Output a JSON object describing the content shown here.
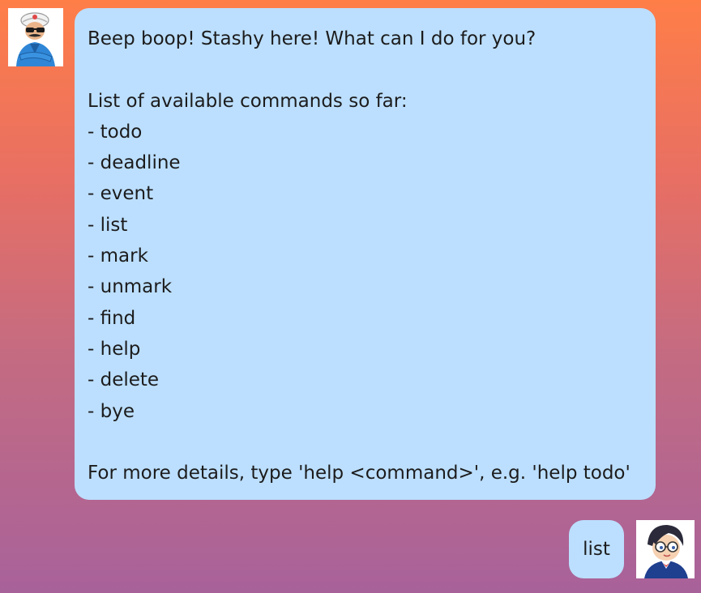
{
  "conversation": {
    "bot": {
      "avatar_icon": "genie-bot-avatar-icon",
      "greeting": "Beep boop! Stashy here! What can I do for you?",
      "commands_heading": "List of available commands so far:",
      "commands": [
        "- todo",
        "- deadline",
        "- event",
        "- list",
        "- mark",
        "- unmark",
        "- find",
        "- help",
        "- delete",
        "- bye"
      ],
      "footer": "For more details, type 'help <command>', e.g. 'help todo'"
    },
    "user": {
      "avatar_icon": "detective-user-avatar-icon",
      "message": "list"
    }
  },
  "colors": {
    "bubble": "#bcdfff",
    "background_top": "#ff7e48",
    "background_bottom": "#a8629a"
  }
}
